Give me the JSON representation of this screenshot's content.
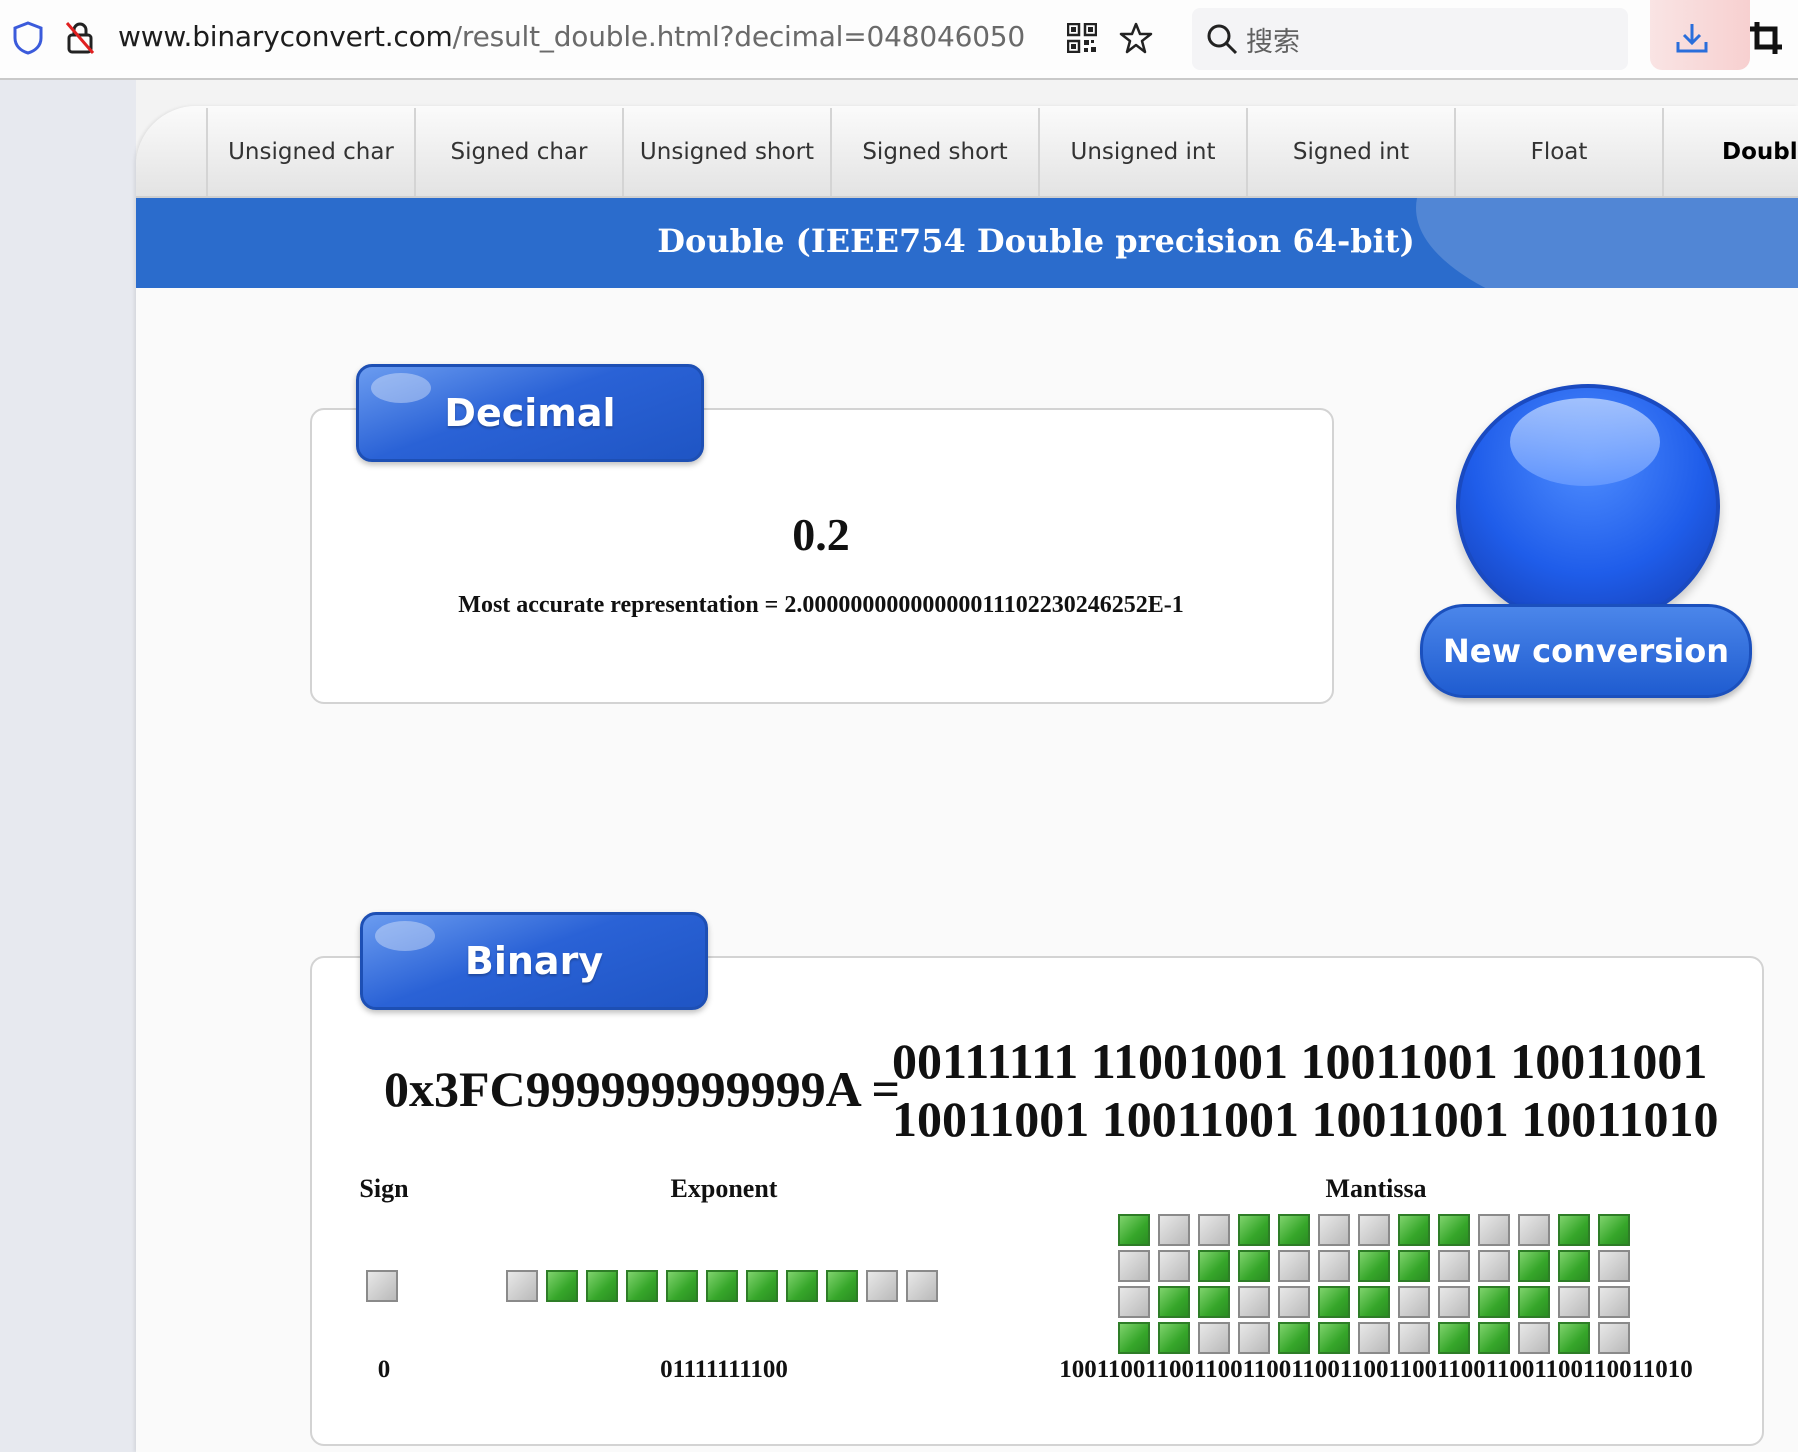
{
  "browser": {
    "url_host": "www.binaryconvert.com",
    "url_path": "/result_double.html?decimal=048046050",
    "search_placeholder": "搜索"
  },
  "nav": {
    "tabs": [
      "Unsigned char",
      "Signed char",
      "Unsigned short",
      "Signed short",
      "Unsigned int",
      "Signed int",
      "Float",
      "Double"
    ],
    "active": "Double"
  },
  "banner": {
    "title": "Double (IEEE754 Double precision 64-bit)"
  },
  "decimal": {
    "label": "Decimal",
    "value": "0.2",
    "accurate": "Most accurate representation = 2.00000000000000011102230246252E-1"
  },
  "new_conversion": {
    "label": "New conversion"
  },
  "binary": {
    "label": "Binary",
    "hex": "0x3FC999999999999A =",
    "line1": "00111111 11001001 10011001 10011001",
    "line2": "10011001 10011001 10011001 10011010",
    "sign": {
      "title": "Sign",
      "bits": "0"
    },
    "exponent": {
      "title": "Exponent",
      "bits": "01111111100"
    },
    "mantissa": {
      "title": "Mantissa",
      "bits": "1001100110011001100110011001100110011001100110011010"
    }
  },
  "colors": {
    "accent": "#2b6ccc",
    "bit_on": "#36a62a",
    "bit_off": "#b9b9b9"
  }
}
